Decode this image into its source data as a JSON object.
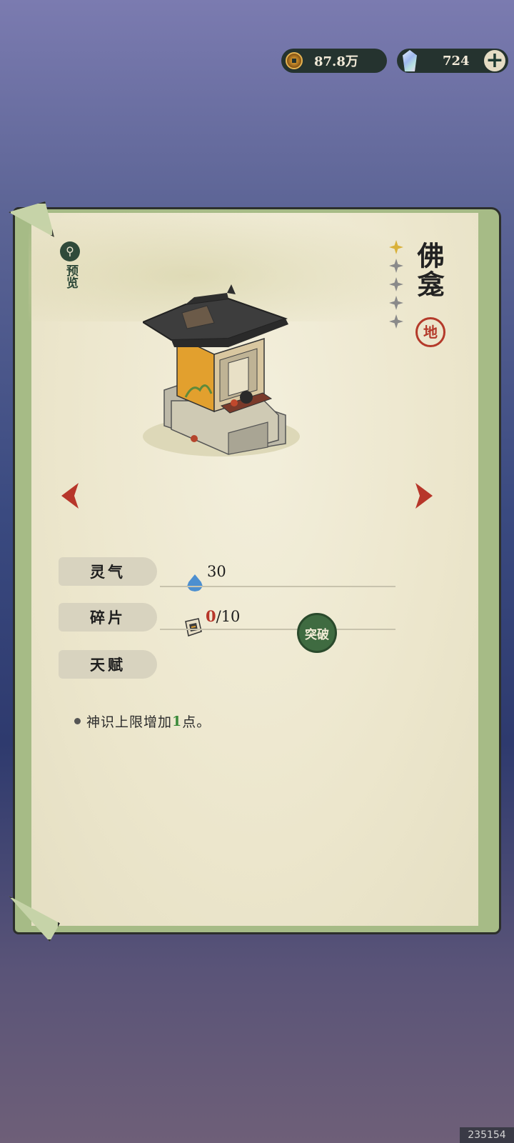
{
  "currency": {
    "coins": "87.8万",
    "gems": "724",
    "add_label": "+"
  },
  "item": {
    "preview_label": "预览",
    "name": "佛龛",
    "grade": "地",
    "stars": [
      true,
      false,
      false,
      false,
      false
    ]
  },
  "stats": {
    "lingqi_label": "灵气",
    "lingqi_value": "30",
    "fragment_label": "碎片",
    "fragment_have": "0",
    "fragment_need": "/10",
    "break_label": "突破",
    "talent_label": "天赋",
    "talent_text_pre": "神识上限增加",
    "talent_text_num": "1",
    "talent_text_post": "点。"
  },
  "watermark": "235154",
  "icons": {
    "coin": "coin-icon",
    "gem": "gem-icon",
    "preview": "magnify-icon",
    "lingqi": "water-drop-icon",
    "fragment": "fragment-icon"
  }
}
